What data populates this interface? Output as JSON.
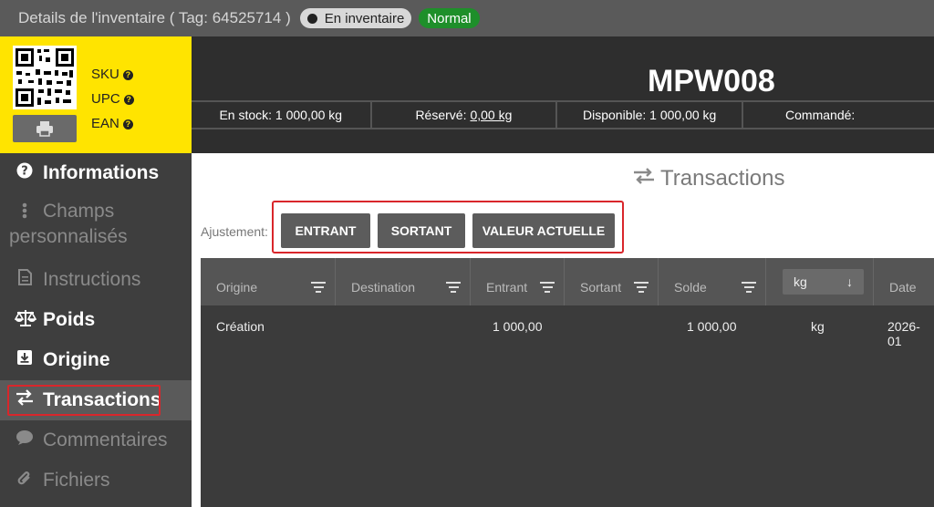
{
  "titlebar": {
    "title": "Details de l'inventaire ( Tag: 64525714 )",
    "status_inventory": "En inventaire",
    "status_normal": "Normal"
  },
  "idbox": {
    "sku_label": "SKU",
    "upc_label": "UPC",
    "ean_label": "EAN",
    "help_glyph": "?"
  },
  "nav": {
    "items": [
      {
        "label": "Informations",
        "icon": "question-circle-icon"
      },
      {
        "label": "Champs personnalisés",
        "icon": "vertical-dots-icon"
      },
      {
        "label": "Instructions",
        "icon": "document-icon"
      },
      {
        "label": "Poids",
        "icon": "scale-icon"
      },
      {
        "label": "Origine",
        "icon": "download-box-icon"
      },
      {
        "label": "Transactions",
        "icon": "arrows-exchange-icon"
      },
      {
        "label": "Commentaires",
        "icon": "speech-bubble-icon"
      },
      {
        "label": "Fichiers",
        "icon": "paperclip-icon"
      }
    ]
  },
  "header": {
    "code": "MPW008",
    "stock_label": "En stock: 1 000,00 kg",
    "reserved_label": "Réservé:",
    "reserved_value": "0,00 kg",
    "available_label": "Disponible: 1 000,00 kg",
    "ordered_label": "Commandé:"
  },
  "transactions": {
    "title": "Transactions",
    "adjust_label": "Ajustement:",
    "btn_in": "ENTRANT",
    "btn_out": "SORTANT",
    "btn_current": "VALEUR ACTUELLE",
    "columns": [
      "Origine",
      "Destination",
      "Entrant",
      "Sortant",
      "Solde",
      "kg",
      "Date"
    ],
    "rows": [
      {
        "origin": "Création",
        "destination": "",
        "in": "1 000,00",
        "out": "",
        "balance": "1 000,00",
        "unit": "kg",
        "date": "2026-01"
      }
    ]
  },
  "colors": {
    "accent_yellow": "#ffe400",
    "highlight_red": "#d9262b",
    "status_green": "#1e8f2a"
  }
}
